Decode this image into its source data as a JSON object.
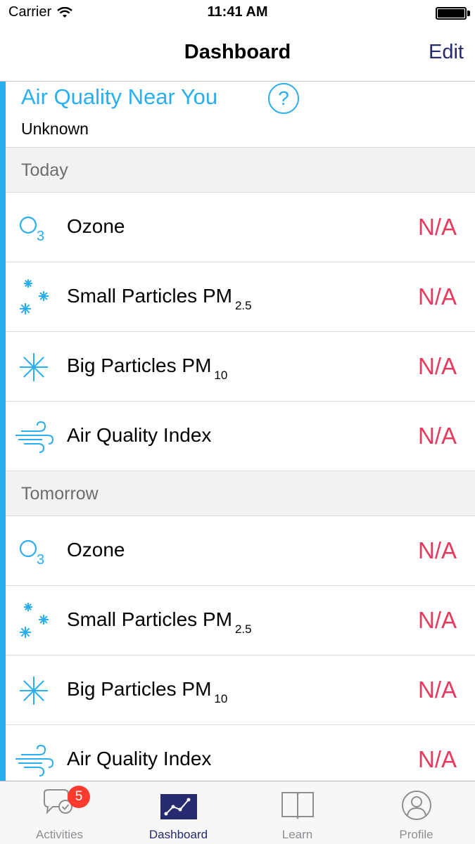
{
  "status_bar": {
    "carrier": "Carrier",
    "time": "11:41 AM"
  },
  "nav": {
    "title": "Dashboard",
    "edit": "Edit"
  },
  "header": {
    "title": "Air Quality Near You",
    "help": "?",
    "status": "Unknown"
  },
  "sections": [
    {
      "label": "Today",
      "rows": [
        {
          "icon": "ozone-icon",
          "label": "Ozone",
          "sub": "",
          "value": "N/A"
        },
        {
          "icon": "small-particles-icon",
          "label": "Small Particles PM",
          "sub": "2.5",
          "value": "N/A"
        },
        {
          "icon": "big-particles-icon",
          "label": "Big Particles PM",
          "sub": "10",
          "value": "N/A"
        },
        {
          "icon": "wind-icon",
          "label": "Air Quality Index",
          "sub": "",
          "value": "N/A"
        }
      ]
    },
    {
      "label": "Tomorrow",
      "rows": [
        {
          "icon": "ozone-icon",
          "label": "Ozone",
          "sub": "",
          "value": "N/A"
        },
        {
          "icon": "small-particles-icon",
          "label": "Small Particles PM",
          "sub": "2.5",
          "value": "N/A"
        },
        {
          "icon": "big-particles-icon",
          "label": "Big Particles PM",
          "sub": "10",
          "value": "N/A"
        },
        {
          "icon": "wind-icon",
          "label": "Air Quality Index",
          "sub": "",
          "value": "N/A"
        }
      ]
    }
  ],
  "tabs": [
    {
      "label": "Activities",
      "icon": "activities-icon",
      "badge": "5",
      "active": false
    },
    {
      "label": "Dashboard",
      "icon": "dashboard-icon",
      "badge": "",
      "active": true
    },
    {
      "label": "Learn",
      "icon": "book-icon",
      "badge": "",
      "active": false
    },
    {
      "label": "Profile",
      "icon": "profile-icon",
      "badge": "",
      "active": false
    }
  ],
  "colors": {
    "accent": "#29aeef",
    "value": "#e83a5f",
    "tab_active": "#262a6e",
    "section_bg": "#f2f2f2"
  }
}
